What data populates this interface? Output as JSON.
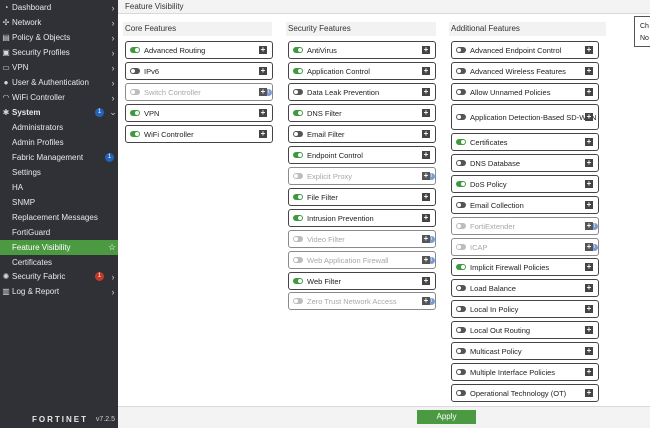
{
  "sidebar": {
    "items": [
      {
        "label": "Dashboard",
        "icon": "dashboard-icon",
        "chevron": true
      },
      {
        "label": "Network",
        "icon": "network-icon",
        "chevron": true
      },
      {
        "label": "Policy & Objects",
        "icon": "policy-icon",
        "chevron": true
      },
      {
        "label": "Security Profiles",
        "icon": "lock-icon",
        "chevron": true
      },
      {
        "label": "VPN",
        "icon": "vpn-icon",
        "chevron": true
      },
      {
        "label": "User & Authentication",
        "icon": "user-icon",
        "chevron": true
      },
      {
        "label": "WiFi Controller",
        "icon": "wifi-icon",
        "chevron": true
      },
      {
        "label": "System",
        "icon": "gear-icon",
        "badge": "1",
        "expanded": true
      },
      {
        "label": "Administrators"
      },
      {
        "label": "Admin Profiles"
      },
      {
        "label": "Fabric Management",
        "badge": "1"
      },
      {
        "label": "Settings"
      },
      {
        "label": "HA"
      },
      {
        "label": "SNMP"
      },
      {
        "label": "Replacement Messages"
      },
      {
        "label": "FortiGuard"
      },
      {
        "label": "Feature Visibility",
        "active": true
      },
      {
        "label": "Certificates"
      },
      {
        "label": "Security Fabric",
        "icon": "fabric-icon",
        "badge": "1",
        "chevron": true
      },
      {
        "label": "Log & Report",
        "icon": "chart-icon",
        "chevron": true
      }
    ],
    "brand": "FORTINET",
    "version": "v7.2.5"
  },
  "page": {
    "title": "Feature Visibility",
    "apply_label": "Apply",
    "popup_lines": [
      "Ch",
      "No"
    ]
  },
  "columns": {
    "core": {
      "header": "Core Features",
      "features": [
        {
          "name": "Advanced Routing",
          "state": "on"
        },
        {
          "name": "IPv6",
          "state": "off"
        },
        {
          "name": "Switch Controller",
          "state": "disabled",
          "info": true
        },
        {
          "name": "VPN",
          "state": "on"
        },
        {
          "name": "WiFi Controller",
          "state": "on"
        }
      ]
    },
    "security": {
      "header": "Security Features",
      "features": [
        {
          "name": "AntiVirus",
          "state": "on"
        },
        {
          "name": "Application Control",
          "state": "on"
        },
        {
          "name": "Data Leak Prevention",
          "state": "off"
        },
        {
          "name": "DNS Filter",
          "state": "on"
        },
        {
          "name": "Email Filter",
          "state": "off"
        },
        {
          "name": "Endpoint Control",
          "state": "on"
        },
        {
          "name": "Explicit Proxy",
          "state": "disabled",
          "info": true
        },
        {
          "name": "File Filter",
          "state": "on"
        },
        {
          "name": "Intrusion Prevention",
          "state": "on"
        },
        {
          "name": "Video Filter",
          "state": "disabled",
          "info": true
        },
        {
          "name": "Web Application Firewall",
          "state": "disabled",
          "info": true
        },
        {
          "name": "Web Filter",
          "state": "on"
        },
        {
          "name": "Zero Trust Network Access",
          "state": "disabled",
          "info": true
        }
      ]
    },
    "additional": {
      "header": "Additional Features",
      "features": [
        {
          "name": "Advanced Endpoint Control",
          "state": "off"
        },
        {
          "name": "Advanced Wireless Features",
          "state": "off"
        },
        {
          "name": "Allow Unnamed Policies",
          "state": "off"
        },
        {
          "name": "Application Detection-Based SD-WAN",
          "state": "off"
        },
        {
          "name": "Certificates",
          "state": "on"
        },
        {
          "name": "DNS Database",
          "state": "off"
        },
        {
          "name": "DoS Policy",
          "state": "on"
        },
        {
          "name": "Email Collection",
          "state": "off"
        },
        {
          "name": "FortiExtender",
          "state": "disabled",
          "info": true
        },
        {
          "name": "ICAP",
          "state": "disabled",
          "info": true
        },
        {
          "name": "Implicit Firewall Policies",
          "state": "on"
        },
        {
          "name": "Load Balance",
          "state": "off"
        },
        {
          "name": "Local In Policy",
          "state": "off"
        },
        {
          "name": "Local Out Routing",
          "state": "off"
        },
        {
          "name": "Multicast Policy",
          "state": "off"
        },
        {
          "name": "Multiple Interface Policies",
          "state": "off"
        },
        {
          "name": "Operational Technology (OT)",
          "state": "off"
        }
      ]
    }
  },
  "colors": {
    "sidebar_bg": "#2f3136",
    "accent_green": "#4b9a42",
    "toggle_on": "#3f9a3f",
    "badge_blue": "#2563b8",
    "badge_red": "#c0392b"
  }
}
